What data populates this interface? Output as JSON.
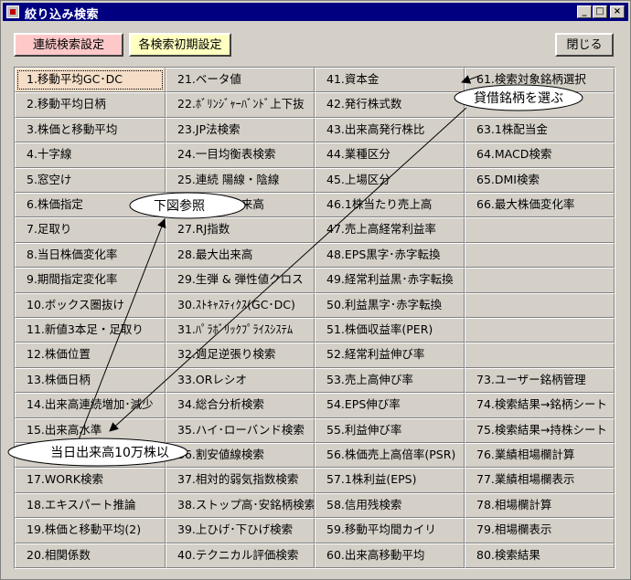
{
  "window": {
    "title": "絞り込み検索",
    "minimize": "_",
    "maximize": "□",
    "close": "×"
  },
  "toolbar": {
    "continuous_label": "連続検索設定",
    "init_label": "各検索初期設定",
    "close_label": "閉じる"
  },
  "columns": [
    [
      "1.移動平均GC･DC",
      "2.移動平均日柄",
      "3.株価と移動平均",
      "4.十字線",
      "5.窓空け",
      "6.株価指定",
      "7.足取り",
      "8.当日株価変化率",
      "9.期間指定変化率",
      "10.ボックス圏抜け",
      "11.新値3本足・足取り",
      "12.株価位置",
      "13.株価日柄",
      "14.出来高連続増加･減少",
      "15.出来高水準",
      "16.出来高急増",
      "17.WORK検索",
      "18.エキスパート推論",
      "19.株価と移動平均(2)",
      "20.相関係数"
    ],
    [
      "21.ベータ値",
      "22.ﾎﾞﾘﾝｼﾞｬｰﾊﾞﾝﾄﾞ上下抜",
      "23.JP法検索",
      "24.一目均衡表検索",
      "25.連続 陽線・陰線",
      "26.株価と出来高",
      "27.RJ指数",
      "28.最大出来高",
      "29.生弾 & 弾性値クロス",
      "30.ｽﾄｷｬｽﾃｨｸｽ(GC･DC)",
      "31.ﾊﾟﾗﾎﾞﾘｯｸﾌﾟﾗｲｽｼｽﾃﾑ",
      "32.週足逆張り検索",
      "33.ORレシオ",
      "34.総合分析検索",
      "35.ハイ･ローバンド検索",
      "36.割安値線検索",
      "37.相対的弱気指数検索",
      "38.ストップ高･安銘柄検索",
      "39.上ひげ･下ひげ検索",
      "40.テクニカル評価検索"
    ],
    [
      "41.資本金",
      "42.発行株式数",
      "43.出来高発行株比",
      "44.業種区分",
      "45.上場区分",
      "46.1株当たり売上高",
      "47.売上高経常利益率",
      "48.EPS黒字･赤字転換",
      "49.経常利益黒･赤字転換",
      "50.利益黒字･赤字転換",
      "51.株価収益率(PER)",
      "52.経常利益伸び率",
      "53.売上高伸び率",
      "54.EPS伸び率",
      "55.利益伸び率",
      "56.株価売上高倍率(PSR)",
      "57.1株利益(EPS)",
      "58.信用残検索",
      "59.移動平均間カイリ",
      "60.出来高移動平均"
    ],
    [
      "61.検索対象銘柄選択",
      "62.貸借銘柄",
      "63.1株配当金",
      "64.MACD検索",
      "65.DMI検索",
      "66.最大株価変化率",
      "",
      "",
      "",
      "",
      "",
      "",
      "73.ユーザー銘柄管理",
      "74.検索結果→銘柄シート",
      "75.検索結果→持株シート",
      "76.業績相場欄計算",
      "77.業績相場欄表示",
      "78.相場欄計算",
      "79.相場欄表示",
      "80.検索結果"
    ]
  ],
  "annotations": {
    "note1": "貸借銘柄を選ぶ",
    "note2": "下図参照",
    "note3": "当日出来高10万株以"
  },
  "colors": {
    "title_bar": "#000080",
    "continuous_btn": "#ffc8c8",
    "init_btn": "#ffffc0",
    "face": "#d4d0c8"
  }
}
